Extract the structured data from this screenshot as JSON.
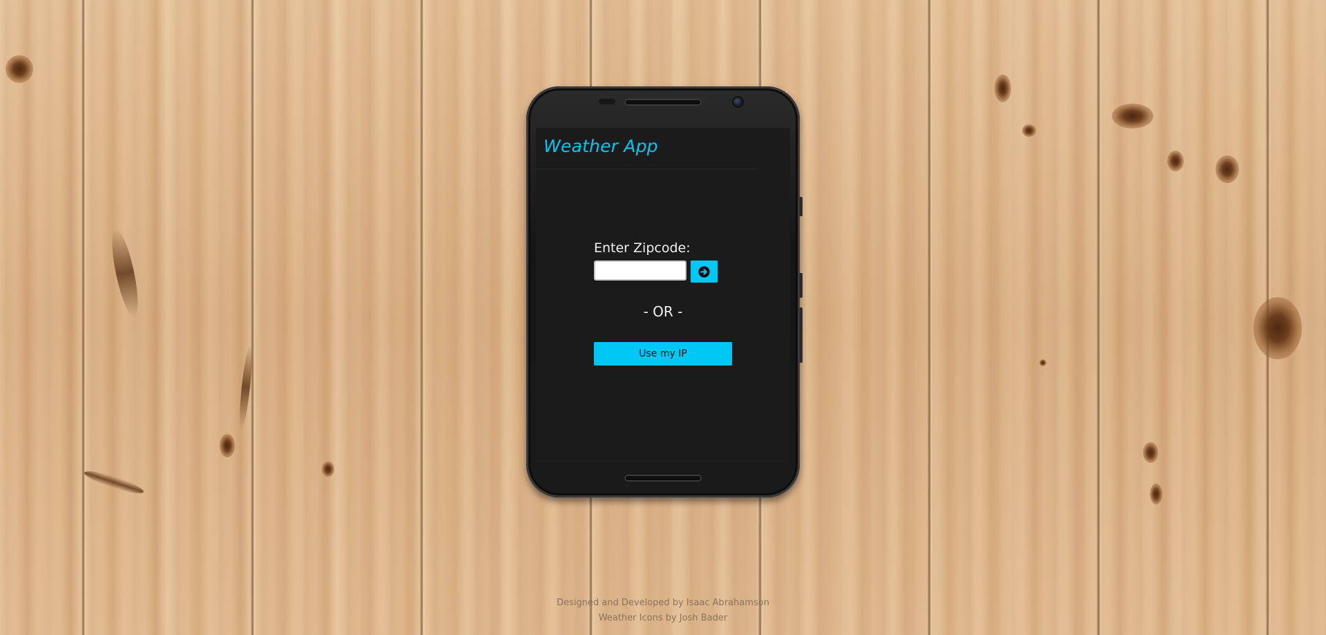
{
  "app": {
    "title": "Weather App"
  },
  "form": {
    "zip_label": "Enter Zipcode:",
    "zip_value": "",
    "zip_placeholder": "",
    "go_icon": "arrow-circle-right-icon",
    "or_text": "- OR -",
    "ip_button_label": "Use my IP"
  },
  "footer": {
    "credit_line": "Designed and Developed by Isaac Abrahamson",
    "icons_line": "Weather Icons by Josh Bader"
  },
  "colors": {
    "accent": "#00c8f5",
    "screen_bg": "#1b1b1b",
    "text": "#f2f2f2"
  }
}
